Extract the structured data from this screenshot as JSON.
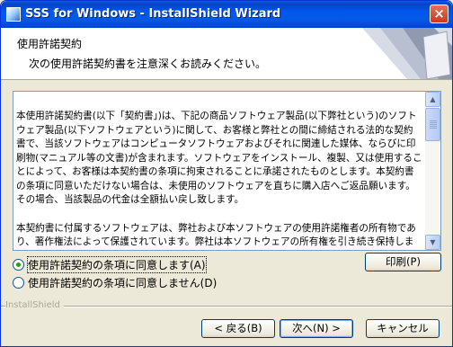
{
  "window": {
    "title": "SSS for Windows - InstallShield Wizard",
    "close_icon": "×"
  },
  "header": {
    "title": "使用許諾契約",
    "subtitle": "次の使用許諾契約書を注意深くお読みください。"
  },
  "license": {
    "paragraph1": "本使用許諾契約書(以下「契約書」)は、下記の商品ソフトウェア製品(以下弊社という)のソフトウェア製品(以下ソフトウェアという)に関して、お客様と弊社との間に締結される法的な契約書で、当該ソフトウェアはコンピュータソフトウェアおよびそれに関連した媒体、ならびに印刷物(マニュアル等の文書)が含まれます。ソフトウェアをインストール、複製、又は使用することによって、お客様は本契約書の条項に拘束されることに承諾されたものとします。本契約書の条項に同意いただけない場合は、未使用のソフトウェアを直ちに購入店へご返品願います。その場合、当該製品の代金は全額払い戻し致します。",
    "paragraph2": "本契約書に付属するソフトウェアは、弊社および本ソフトウェアの使用許諾権者の所有物であり、著作権法によって保護されています。弊社は本ソフトウェアの所有権を引き続き保持しますが、本契約"
  },
  "options": {
    "accept_label": "使用許諾契約の条項に同意します(A)",
    "decline_label": "使用許諾契約の条項に同意しません(D)",
    "accept_selected": true
  },
  "buttons": {
    "print": "印刷(P)",
    "back": "< 戻る(B)",
    "next": "次へ(N) >",
    "cancel": "キャンセル"
  },
  "branding": "InstallShield",
  "colors": {
    "titlebar": "#0058ee",
    "radio_dot": "#21a121",
    "border": "#7f9db9"
  }
}
